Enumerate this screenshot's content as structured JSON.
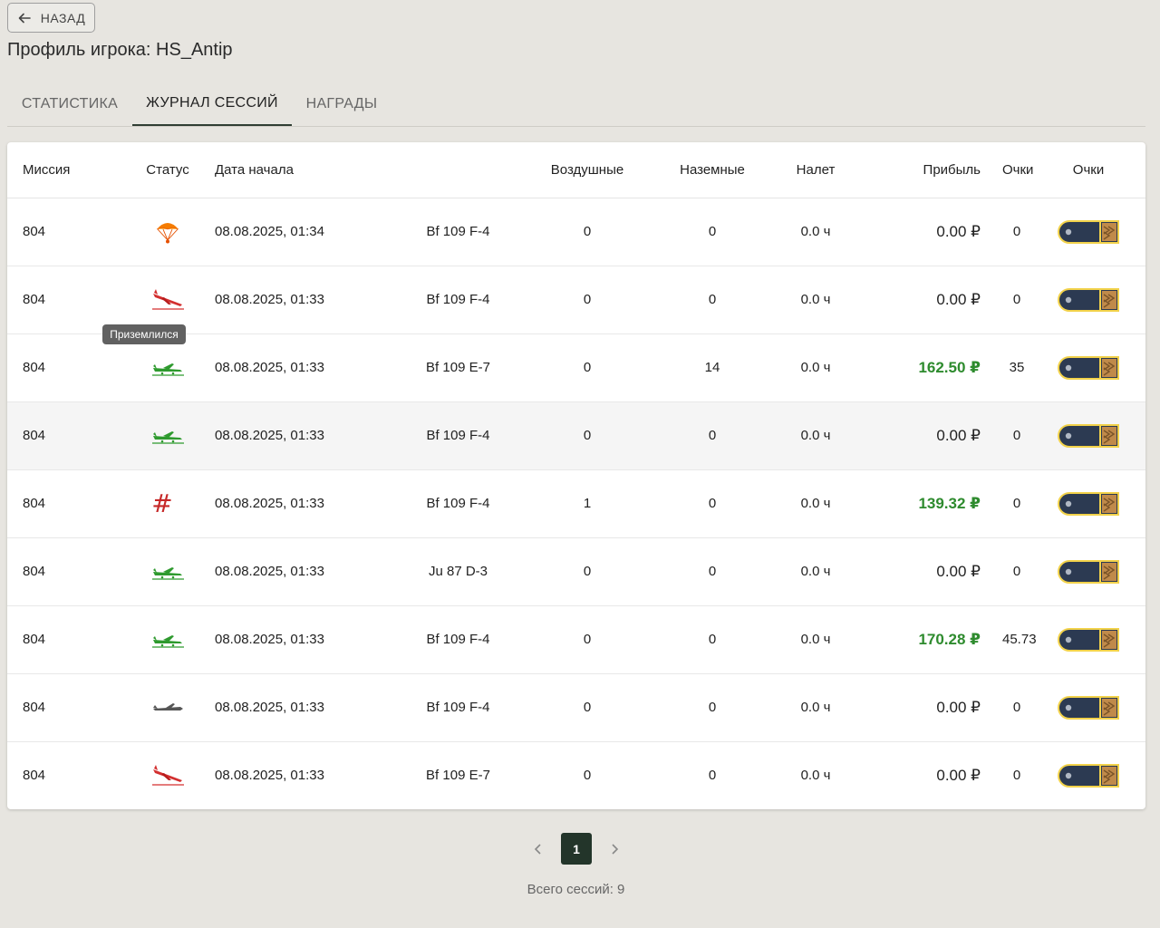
{
  "back_label": "НАЗАД",
  "title": "Профиль игрока: HS_Antip",
  "tabs": [
    {
      "label": "СТАТИСТИКА",
      "active": false
    },
    {
      "label": "ЖУРНАЛ СЕССИЙ",
      "active": true
    },
    {
      "label": "НАГРАДЫ",
      "active": false
    }
  ],
  "columns": {
    "mission": "Миссия",
    "status": "Статус",
    "date": "Дата начала",
    "air": "Воздушные",
    "ground": "Наземные",
    "flight": "Налет",
    "profit": "Прибыль",
    "points": "Очки",
    "rank": "Очки"
  },
  "rows": [
    {
      "mission": "804",
      "status": "parachute-icon",
      "date": "08.08.2025, 01:34",
      "plane": "Bf 109 F-4",
      "air": "0",
      "ground": "0",
      "flight": "0.0 ч",
      "profit": "0.00 ₽",
      "profit_positive": false,
      "points": "0"
    },
    {
      "mission": "804",
      "status": "crashed-plane-icon",
      "date": "08.08.2025, 01:33",
      "plane": "Bf 109 F-4",
      "air": "0",
      "ground": "0",
      "flight": "0.0 ч",
      "profit": "0.00 ₽",
      "profit_positive": false,
      "points": "0"
    },
    {
      "mission": "804",
      "status": "landed-plane-icon",
      "date": "08.08.2025, 01:33",
      "plane": "Bf 109 E-7",
      "air": "0",
      "ground": "14",
      "flight": "0.0 ч",
      "profit": "162.50 ₽",
      "profit_positive": true,
      "points": "35"
    },
    {
      "mission": "804",
      "status": "landed-plane-icon",
      "date": "08.08.2025, 01:33",
      "plane": "Bf 109 F-4",
      "air": "0",
      "ground": "0",
      "flight": "0.0 ч",
      "profit": "0.00 ₽",
      "profit_positive": false,
      "points": "0"
    },
    {
      "mission": "804",
      "status": "hash-icon",
      "date": "08.08.2025, 01:33",
      "plane": "Bf 109 F-4",
      "air": "1",
      "ground": "0",
      "flight": "0.0 ч",
      "profit": "139.32 ₽",
      "profit_positive": true,
      "points": "0"
    },
    {
      "mission": "804",
      "status": "landed-plane-icon",
      "date": "08.08.2025, 01:33",
      "plane": "Ju 87 D-3",
      "air": "0",
      "ground": "0",
      "flight": "0.0 ч",
      "profit": "0.00 ₽",
      "profit_positive": false,
      "points": "0"
    },
    {
      "mission": "804",
      "status": "landed-plane-icon",
      "date": "08.08.2025, 01:33",
      "plane": "Bf 109 F-4",
      "air": "0",
      "ground": "0",
      "flight": "0.0 ч",
      "profit": "170.28 ₽",
      "profit_positive": true,
      "points": "45.73"
    },
    {
      "mission": "804",
      "status": "grey-plane-icon",
      "date": "08.08.2025, 01:33",
      "plane": "Bf 109 F-4",
      "air": "0",
      "ground": "0",
      "flight": "0.0 ч",
      "profit": "0.00 ₽",
      "profit_positive": false,
      "points": "0"
    },
    {
      "mission": "804",
      "status": "crashed-plane-icon",
      "date": "08.08.2025, 01:33",
      "plane": "Bf 109 E-7",
      "air": "0",
      "ground": "0",
      "flight": "0.0 ч",
      "profit": "0.00 ₽",
      "profit_positive": false,
      "points": "0"
    }
  ],
  "tooltip": "Приземлился",
  "pagination": {
    "current": "1"
  },
  "total_label": "Всего сессий: 9",
  "colors": {
    "accent": "#23352a",
    "profit_positive": "#2e8b2e",
    "landed": "#2e9a2e",
    "crashed": "#d32f2f",
    "parachute": "#f57c00"
  }
}
